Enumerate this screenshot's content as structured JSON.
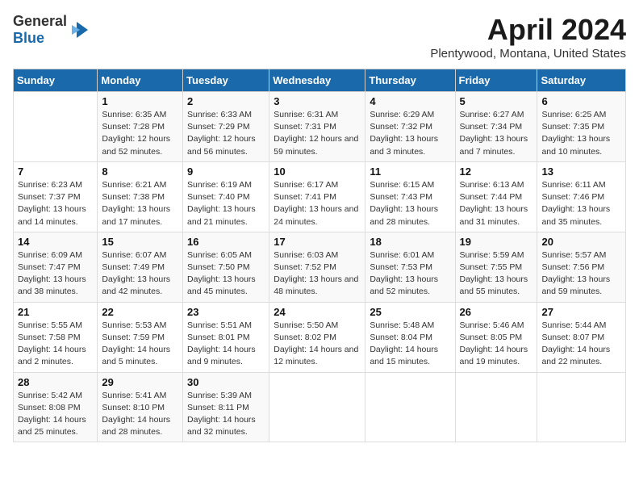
{
  "logo": {
    "general": "General",
    "blue": "Blue"
  },
  "title": "April 2024",
  "subtitle": "Plentywood, Montana, United States",
  "days_of_week": [
    "Sunday",
    "Monday",
    "Tuesday",
    "Wednesday",
    "Thursday",
    "Friday",
    "Saturday"
  ],
  "weeks": [
    [
      {
        "day": "",
        "sunrise": "",
        "sunset": "",
        "daylight": ""
      },
      {
        "day": "1",
        "sunrise": "Sunrise: 6:35 AM",
        "sunset": "Sunset: 7:28 PM",
        "daylight": "Daylight: 12 hours and 52 minutes."
      },
      {
        "day": "2",
        "sunrise": "Sunrise: 6:33 AM",
        "sunset": "Sunset: 7:29 PM",
        "daylight": "Daylight: 12 hours and 56 minutes."
      },
      {
        "day": "3",
        "sunrise": "Sunrise: 6:31 AM",
        "sunset": "Sunset: 7:31 PM",
        "daylight": "Daylight: 12 hours and 59 minutes."
      },
      {
        "day": "4",
        "sunrise": "Sunrise: 6:29 AM",
        "sunset": "Sunset: 7:32 PM",
        "daylight": "Daylight: 13 hours and 3 minutes."
      },
      {
        "day": "5",
        "sunrise": "Sunrise: 6:27 AM",
        "sunset": "Sunset: 7:34 PM",
        "daylight": "Daylight: 13 hours and 7 minutes."
      },
      {
        "day": "6",
        "sunrise": "Sunrise: 6:25 AM",
        "sunset": "Sunset: 7:35 PM",
        "daylight": "Daylight: 13 hours and 10 minutes."
      }
    ],
    [
      {
        "day": "7",
        "sunrise": "Sunrise: 6:23 AM",
        "sunset": "Sunset: 7:37 PM",
        "daylight": "Daylight: 13 hours and 14 minutes."
      },
      {
        "day": "8",
        "sunrise": "Sunrise: 6:21 AM",
        "sunset": "Sunset: 7:38 PM",
        "daylight": "Daylight: 13 hours and 17 minutes."
      },
      {
        "day": "9",
        "sunrise": "Sunrise: 6:19 AM",
        "sunset": "Sunset: 7:40 PM",
        "daylight": "Daylight: 13 hours and 21 minutes."
      },
      {
        "day": "10",
        "sunrise": "Sunrise: 6:17 AM",
        "sunset": "Sunset: 7:41 PM",
        "daylight": "Daylight: 13 hours and 24 minutes."
      },
      {
        "day": "11",
        "sunrise": "Sunrise: 6:15 AM",
        "sunset": "Sunset: 7:43 PM",
        "daylight": "Daylight: 13 hours and 28 minutes."
      },
      {
        "day": "12",
        "sunrise": "Sunrise: 6:13 AM",
        "sunset": "Sunset: 7:44 PM",
        "daylight": "Daylight: 13 hours and 31 minutes."
      },
      {
        "day": "13",
        "sunrise": "Sunrise: 6:11 AM",
        "sunset": "Sunset: 7:46 PM",
        "daylight": "Daylight: 13 hours and 35 minutes."
      }
    ],
    [
      {
        "day": "14",
        "sunrise": "Sunrise: 6:09 AM",
        "sunset": "Sunset: 7:47 PM",
        "daylight": "Daylight: 13 hours and 38 minutes."
      },
      {
        "day": "15",
        "sunrise": "Sunrise: 6:07 AM",
        "sunset": "Sunset: 7:49 PM",
        "daylight": "Daylight: 13 hours and 42 minutes."
      },
      {
        "day": "16",
        "sunrise": "Sunrise: 6:05 AM",
        "sunset": "Sunset: 7:50 PM",
        "daylight": "Daylight: 13 hours and 45 minutes."
      },
      {
        "day": "17",
        "sunrise": "Sunrise: 6:03 AM",
        "sunset": "Sunset: 7:52 PM",
        "daylight": "Daylight: 13 hours and 48 minutes."
      },
      {
        "day": "18",
        "sunrise": "Sunrise: 6:01 AM",
        "sunset": "Sunset: 7:53 PM",
        "daylight": "Daylight: 13 hours and 52 minutes."
      },
      {
        "day": "19",
        "sunrise": "Sunrise: 5:59 AM",
        "sunset": "Sunset: 7:55 PM",
        "daylight": "Daylight: 13 hours and 55 minutes."
      },
      {
        "day": "20",
        "sunrise": "Sunrise: 5:57 AM",
        "sunset": "Sunset: 7:56 PM",
        "daylight": "Daylight: 13 hours and 59 minutes."
      }
    ],
    [
      {
        "day": "21",
        "sunrise": "Sunrise: 5:55 AM",
        "sunset": "Sunset: 7:58 PM",
        "daylight": "Daylight: 14 hours and 2 minutes."
      },
      {
        "day": "22",
        "sunrise": "Sunrise: 5:53 AM",
        "sunset": "Sunset: 7:59 PM",
        "daylight": "Daylight: 14 hours and 5 minutes."
      },
      {
        "day": "23",
        "sunrise": "Sunrise: 5:51 AM",
        "sunset": "Sunset: 8:01 PM",
        "daylight": "Daylight: 14 hours and 9 minutes."
      },
      {
        "day": "24",
        "sunrise": "Sunrise: 5:50 AM",
        "sunset": "Sunset: 8:02 PM",
        "daylight": "Daylight: 14 hours and 12 minutes."
      },
      {
        "day": "25",
        "sunrise": "Sunrise: 5:48 AM",
        "sunset": "Sunset: 8:04 PM",
        "daylight": "Daylight: 14 hours and 15 minutes."
      },
      {
        "day": "26",
        "sunrise": "Sunrise: 5:46 AM",
        "sunset": "Sunset: 8:05 PM",
        "daylight": "Daylight: 14 hours and 19 minutes."
      },
      {
        "day": "27",
        "sunrise": "Sunrise: 5:44 AM",
        "sunset": "Sunset: 8:07 PM",
        "daylight": "Daylight: 14 hours and 22 minutes."
      }
    ],
    [
      {
        "day": "28",
        "sunrise": "Sunrise: 5:42 AM",
        "sunset": "Sunset: 8:08 PM",
        "daylight": "Daylight: 14 hours and 25 minutes."
      },
      {
        "day": "29",
        "sunrise": "Sunrise: 5:41 AM",
        "sunset": "Sunset: 8:10 PM",
        "daylight": "Daylight: 14 hours and 28 minutes."
      },
      {
        "day": "30",
        "sunrise": "Sunrise: 5:39 AM",
        "sunset": "Sunset: 8:11 PM",
        "daylight": "Daylight: 14 hours and 32 minutes."
      },
      {
        "day": "",
        "sunrise": "",
        "sunset": "",
        "daylight": ""
      },
      {
        "day": "",
        "sunrise": "",
        "sunset": "",
        "daylight": ""
      },
      {
        "day": "",
        "sunrise": "",
        "sunset": "",
        "daylight": ""
      },
      {
        "day": "",
        "sunrise": "",
        "sunset": "",
        "daylight": ""
      }
    ]
  ]
}
